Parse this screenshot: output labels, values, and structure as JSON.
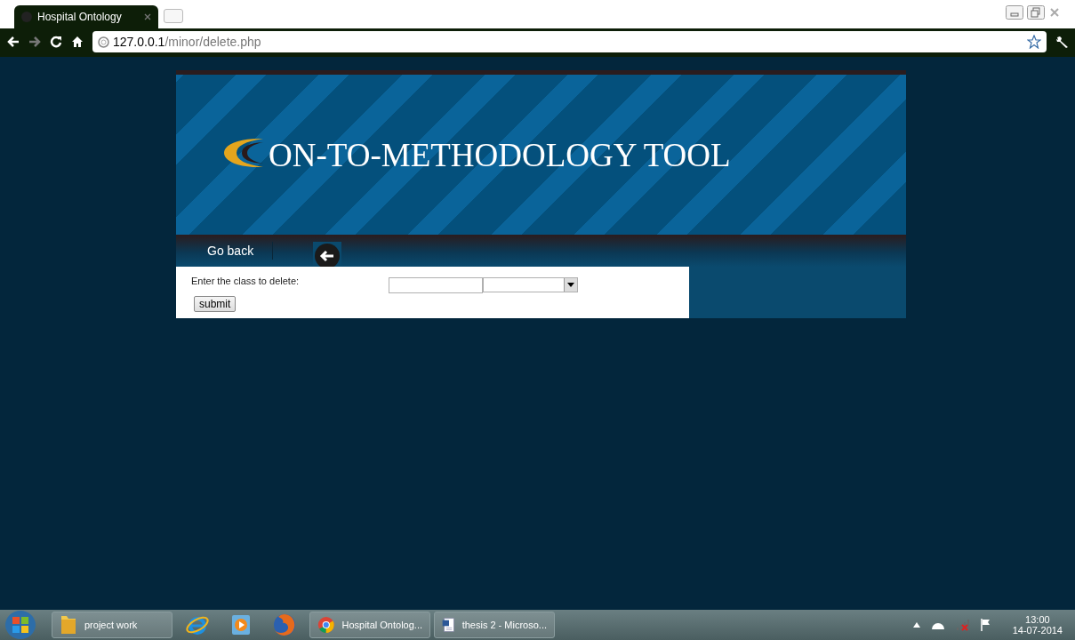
{
  "browser": {
    "tab_title": "Hospital Ontology",
    "url_host": "127.0.0.1",
    "url_path": "/minor/delete.php"
  },
  "site": {
    "title": "ON-TO-METHODOLOGY TOOL",
    "nav": [
      {
        "label": "Go back"
      }
    ]
  },
  "form": {
    "label": "Enter the class to delete:",
    "submit": "submit"
  },
  "taskbar": {
    "items": [
      {
        "kind": "folder",
        "label": "project work"
      },
      {
        "kind": "ie"
      },
      {
        "kind": "media"
      },
      {
        "kind": "firefox"
      },
      {
        "kind": "chrome",
        "label": "Hospital Ontolog..."
      },
      {
        "kind": "word",
        "label": "thesis 2 - Microso..."
      }
    ],
    "time": "13:00",
    "date": "14-07-2014"
  }
}
